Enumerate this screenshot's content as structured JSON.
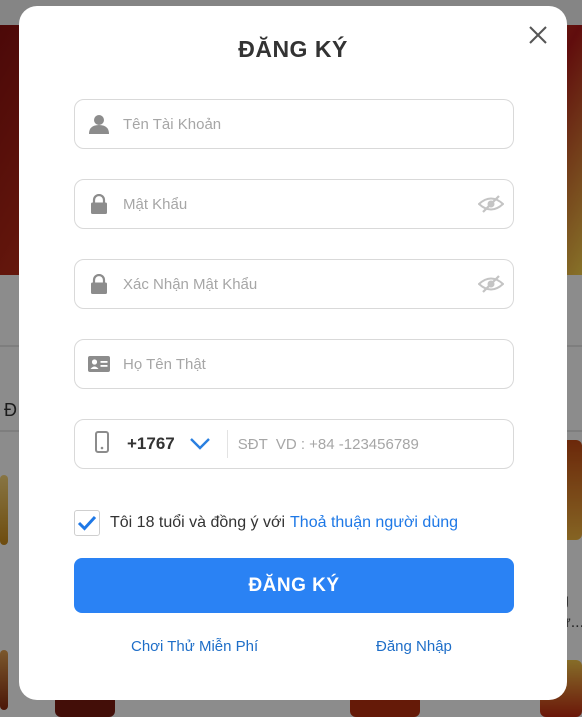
{
  "background": {
    "edge_letter": "Đ",
    "side_text_1": "g",
    "side_text_2": "ư..."
  },
  "modal": {
    "title": "ĐĂNG KÝ",
    "close_icon": "close-icon",
    "fields": {
      "username": {
        "placeholder": "Tên Tài Khoản",
        "value": "",
        "icon": "user-icon"
      },
      "password": {
        "placeholder": "Mật Khẩu",
        "value": "",
        "icon": "lock-icon",
        "toggle_icon": "eye-off-icon"
      },
      "confirm_password": {
        "placeholder": "Xác Nhận Mật Khẩu",
        "value": "",
        "icon": "lock-icon",
        "toggle_icon": "eye-off-icon"
      },
      "real_name": {
        "placeholder": "Họ Tên Thật",
        "value": "",
        "icon": "id-card-icon"
      },
      "phone": {
        "country_code": "+1767",
        "placeholder": "SĐT  VD : +84 -123456789",
        "value": "",
        "icon": "phone-icon",
        "dropdown_icon": "chevron-down-icon"
      }
    },
    "agreement": {
      "checked": true,
      "text": "Tôi 18 tuổi và đồng ý với",
      "link": "Thoả thuận người dùng"
    },
    "submit_label": "ĐĂNG KÝ",
    "links": {
      "free_play": "Chơi Thử Miễn Phí",
      "login": "Đăng Nhập"
    }
  },
  "colors": {
    "primary": "#2a82f4",
    "link": "#1e78e6",
    "icon_gray": "#8c8c8c",
    "text": "#333333"
  }
}
